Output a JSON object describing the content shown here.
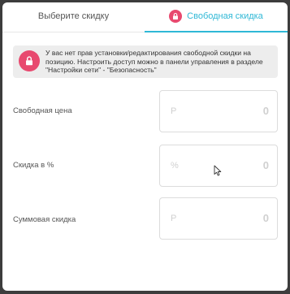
{
  "tabs": {
    "select_discount": "Выберите скидку",
    "free_discount": "Свободная скидка"
  },
  "notice": {
    "text": "У вас нет прав установки/редактирования свободной скидки на позицию. Настроить доступ можно в панели управления в разделе \"Настройки сети\" - \"Безопасность\""
  },
  "fields": [
    {
      "label": "Свободная цена",
      "unit": "Р",
      "value": "0"
    },
    {
      "label": "Скидка в %",
      "unit": "%",
      "value": "0"
    },
    {
      "label": "Суммовая скидка",
      "unit": "Р",
      "value": "0"
    }
  ],
  "colors": {
    "accent": "#2fb8d6",
    "lock": "#e8496f"
  },
  "icons": {
    "tab_lock": "lock-icon",
    "notice_lock": "lock-icon",
    "cursor": "mouse-cursor-icon"
  }
}
